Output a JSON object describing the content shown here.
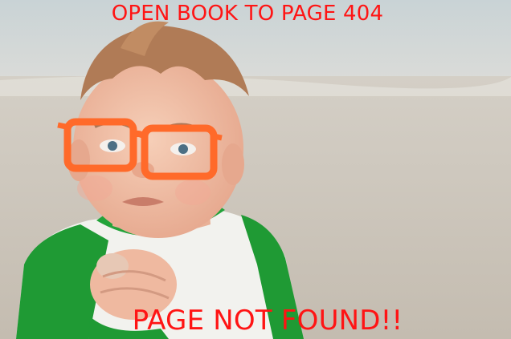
{
  "meme": {
    "top_caption": "OPEN BOOK TO PAGE 404",
    "bottom_caption": "PAGE NOT FOUND!!",
    "caption_color": "#ff1414",
    "glasses_color": "#ff6a2a"
  }
}
